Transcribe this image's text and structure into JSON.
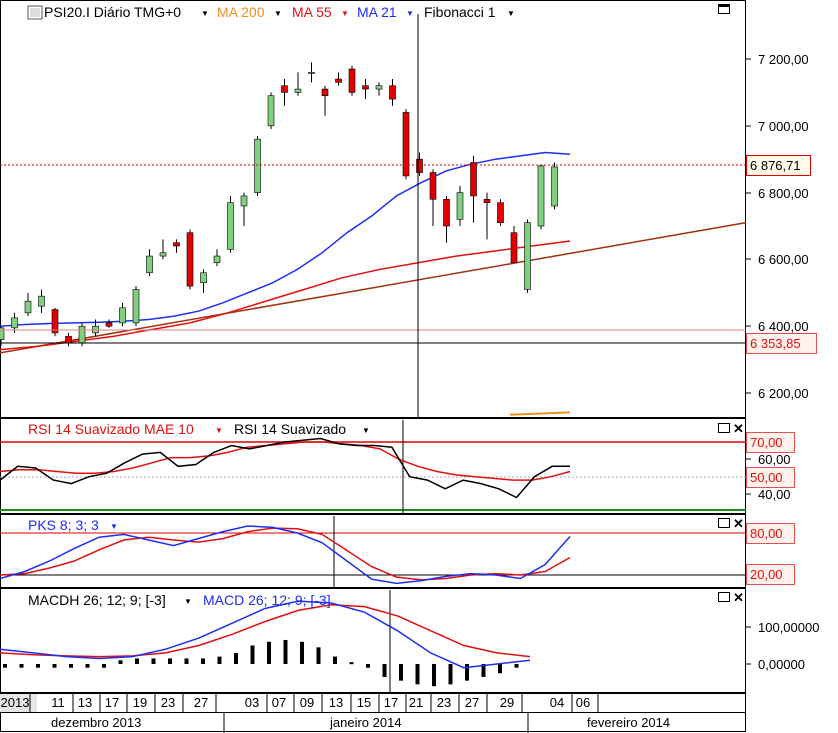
{
  "toolbar": {
    "symbol": "PSI20.I Diário TMG+0",
    "ma200": "MA 200",
    "ma55": "MA 55",
    "ma21": "MA 21",
    "fib": "Fibonacci 1",
    "dropdown_glyph": "▼"
  },
  "rsi_panel": {
    "smooth_label": "RSI 14 Suavizado MAE 10",
    "rsi_label": "RSI 14 Suavizado",
    "ticks": [
      "60,00",
      "40,00"
    ],
    "badges": [
      "70,00",
      "50,00"
    ]
  },
  "pks_panel": {
    "label": "PKS 8; 3; 3",
    "badges": [
      "80,00",
      "20,00"
    ]
  },
  "macd_panel": {
    "hist_label": "MACDH 26; 12; 9; [-3]",
    "macd_label": "MACD 26; 12; 9; [-3]",
    "ticks": [
      "100,00000",
      "0,00000"
    ]
  },
  "price_axis": {
    "ticks": [
      "7 200,00",
      "7 000,00",
      "6 800,00",
      "6 600,00",
      "6 400,00",
      "6 200,00"
    ],
    "last_price": "6 876,71",
    "cursor_price": "6 353,85"
  },
  "time_axis": {
    "days": [
      "2013",
      "11",
      "13",
      "17",
      "19",
      "23",
      "27",
      "03",
      "07",
      "09",
      "13",
      "15",
      "17",
      "21",
      "23",
      "27",
      "29",
      "04",
      "06"
    ],
    "months": [
      "dezembro 2013",
      "janeiro 2014",
      "fevereiro 2014"
    ]
  },
  "colors": {
    "up": "#7fd07f",
    "down": "#e00000",
    "ma21": "#1e2ef0",
    "ma55": "#e01010",
    "ma200": "#f09020",
    "fib": "#a03010",
    "rsi": "#000000",
    "rsi_smooth": "#e01010",
    "pks_k": "#1e2ef0",
    "pks_d": "#e01010"
  },
  "chart_data": {
    "type": "candlestick",
    "ylim": [
      6100,
      7300
    ],
    "candles": [
      {
        "o": 6360,
        "h": 6400,
        "l": 6340,
        "c": 6395
      },
      {
        "o": 6395,
        "h": 6440,
        "l": 6380,
        "c": 6425
      },
      {
        "o": 6440,
        "h": 6500,
        "l": 6430,
        "c": 6475
      },
      {
        "o": 6460,
        "h": 6510,
        "l": 6440,
        "c": 6490
      },
      {
        "o": 6450,
        "h": 6455,
        "l": 6370,
        "c": 6380
      },
      {
        "o": 6370,
        "h": 6380,
        "l": 6340,
        "c": 6350
      },
      {
        "o": 6350,
        "h": 6410,
        "l": 6340,
        "c": 6400
      },
      {
        "o": 6380,
        "h": 6420,
        "l": 6370,
        "c": 6400
      },
      {
        "o": 6410,
        "h": 6420,
        "l": 6395,
        "c": 6400
      },
      {
        "o": 6410,
        "h": 6470,
        "l": 6400,
        "c": 6455
      },
      {
        "o": 6410,
        "h": 6520,
        "l": 6400,
        "c": 6510
      },
      {
        "o": 6560,
        "h": 6630,
        "l": 6550,
        "c": 6610
      },
      {
        "o": 6610,
        "h": 6660,
        "l": 6600,
        "c": 6620
      },
      {
        "o": 6650,
        "h": 6660,
        "l": 6620,
        "c": 6640
      },
      {
        "o": 6680,
        "h": 6690,
        "l": 6510,
        "c": 6520
      },
      {
        "o": 6530,
        "h": 6570,
        "l": 6500,
        "c": 6560
      },
      {
        "o": 6590,
        "h": 6630,
        "l": 6580,
        "c": 6610
      },
      {
        "o": 6630,
        "h": 6790,
        "l": 6620,
        "c": 6770
      },
      {
        "o": 6760,
        "h": 6800,
        "l": 6700,
        "c": 6790
      },
      {
        "o": 6800,
        "h": 6970,
        "l": 6790,
        "c": 6960
      },
      {
        "o": 7000,
        "h": 7100,
        "l": 6990,
        "c": 7090
      },
      {
        "o": 7120,
        "h": 7140,
        "l": 7060,
        "c": 7100
      },
      {
        "o": 7100,
        "h": 7160,
        "l": 7090,
        "c": 7110
      },
      {
        "o": 7160,
        "h": 7190,
        "l": 7130,
        "c": 7160
      },
      {
        "o": 7110,
        "h": 7120,
        "l": 7030,
        "c": 7090
      },
      {
        "o": 7140,
        "h": 7160,
        "l": 7120,
        "c": 7130
      },
      {
        "o": 7170,
        "h": 7180,
        "l": 7090,
        "c": 7100
      },
      {
        "o": 7120,
        "h": 7140,
        "l": 7080,
        "c": 7110
      },
      {
        "o": 7110,
        "h": 7130,
        "l": 7090,
        "c": 7120
      },
      {
        "o": 7120,
        "h": 7140,
        "l": 7060,
        "c": 7080
      },
      {
        "o": 7040,
        "h": 7050,
        "l": 6840,
        "c": 6850
      },
      {
        "o": 6900,
        "h": 6920,
        "l": 6850,
        "c": 6860
      },
      {
        "o": 6860,
        "h": 6870,
        "l": 6700,
        "c": 6780
      },
      {
        "o": 6780,
        "h": 6790,
        "l": 6650,
        "c": 6700
      },
      {
        "o": 6720,
        "h": 6820,
        "l": 6700,
        "c": 6800
      },
      {
        "o": 6890,
        "h": 6910,
        "l": 6710,
        "c": 6790
      },
      {
        "o": 6780,
        "h": 6800,
        "l": 6660,
        "c": 6770
      },
      {
        "o": 6770,
        "h": 6780,
        "l": 6700,
        "c": 6710
      },
      {
        "o": 6680,
        "h": 6700,
        "l": 6620,
        "c": 6590
      },
      {
        "o": 6510,
        "h": 6720,
        "l": 6500,
        "c": 6710
      },
      {
        "o": 6700,
        "h": 6880,
        "l": 6690,
        "c": 6880
      },
      {
        "o": 6760,
        "h": 6890,
        "l": 6750,
        "c": 6877
      }
    ],
    "ma21": [
      6400,
      6405,
      6408,
      6410,
      6412,
      6415,
      6420,
      6430,
      6445,
      6470,
      6500,
      6530,
      6570,
      6620,
      6680,
      6730,
      6790,
      6830,
      6865,
      6885,
      6900,
      6910,
      6920,
      6915
    ],
    "ma55": [
      6330,
      6340,
      6355,
      6370,
      6390,
      6410,
      6440,
      6475,
      6510,
      6545,
      6570,
      6590,
      6610,
      6625,
      6640,
      6655
    ],
    "ma200_segment": [
      6135,
      6142
    ],
    "fibonacci_line": [
      6320,
      6710
    ],
    "rsi": [
      48,
      56,
      55,
      48,
      46,
      50,
      52,
      58,
      63,
      64,
      56,
      57,
      64,
      68,
      66,
      68,
      70,
      71,
      72,
      69,
      68,
      68,
      67,
      50,
      48,
      43,
      48,
      46,
      43,
      38,
      50,
      56,
      56
    ],
    "rsi_smooth": [
      53,
      54,
      54,
      53,
      52,
      52,
      53,
      55,
      58,
      61,
      61,
      62,
      64,
      67,
      68,
      69,
      70,
      70,
      69,
      68,
      66,
      60,
      56,
      53,
      51,
      50,
      49,
      48,
      48,
      50,
      53
    ],
    "pks_k": [
      15,
      25,
      40,
      58,
      74,
      78,
      70,
      62,
      72,
      82,
      90,
      88,
      80,
      66,
      40,
      14,
      8,
      12,
      18,
      22,
      20,
      15,
      35,
      75
    ],
    "pks_d": [
      20,
      22,
      30,
      40,
      56,
      70,
      74,
      70,
      67,
      72,
      82,
      87,
      86,
      78,
      55,
      32,
      17,
      13,
      15,
      20,
      22,
      20,
      25,
      45
    ],
    "macd": [
      40,
      30,
      20,
      15,
      20,
      40,
      70,
      110,
      150,
      170,
      165,
      140,
      90,
      30,
      -10,
      0,
      10
    ],
    "macd_signal": [
      30,
      25,
      22,
      20,
      22,
      30,
      50,
      80,
      115,
      145,
      160,
      155,
      130,
      90,
      50,
      30,
      20
    ],
    "macdh": [
      -10,
      -10,
      -10,
      -10,
      -10,
      -10,
      -10,
      10,
      15,
      15,
      15,
      15,
      15,
      20,
      30,
      50,
      60,
      65,
      60,
      45,
      20,
      5,
      -10,
      -35,
      -45,
      -55,
      -60,
      -55,
      -45,
      -35,
      -25,
      -10
    ]
  }
}
